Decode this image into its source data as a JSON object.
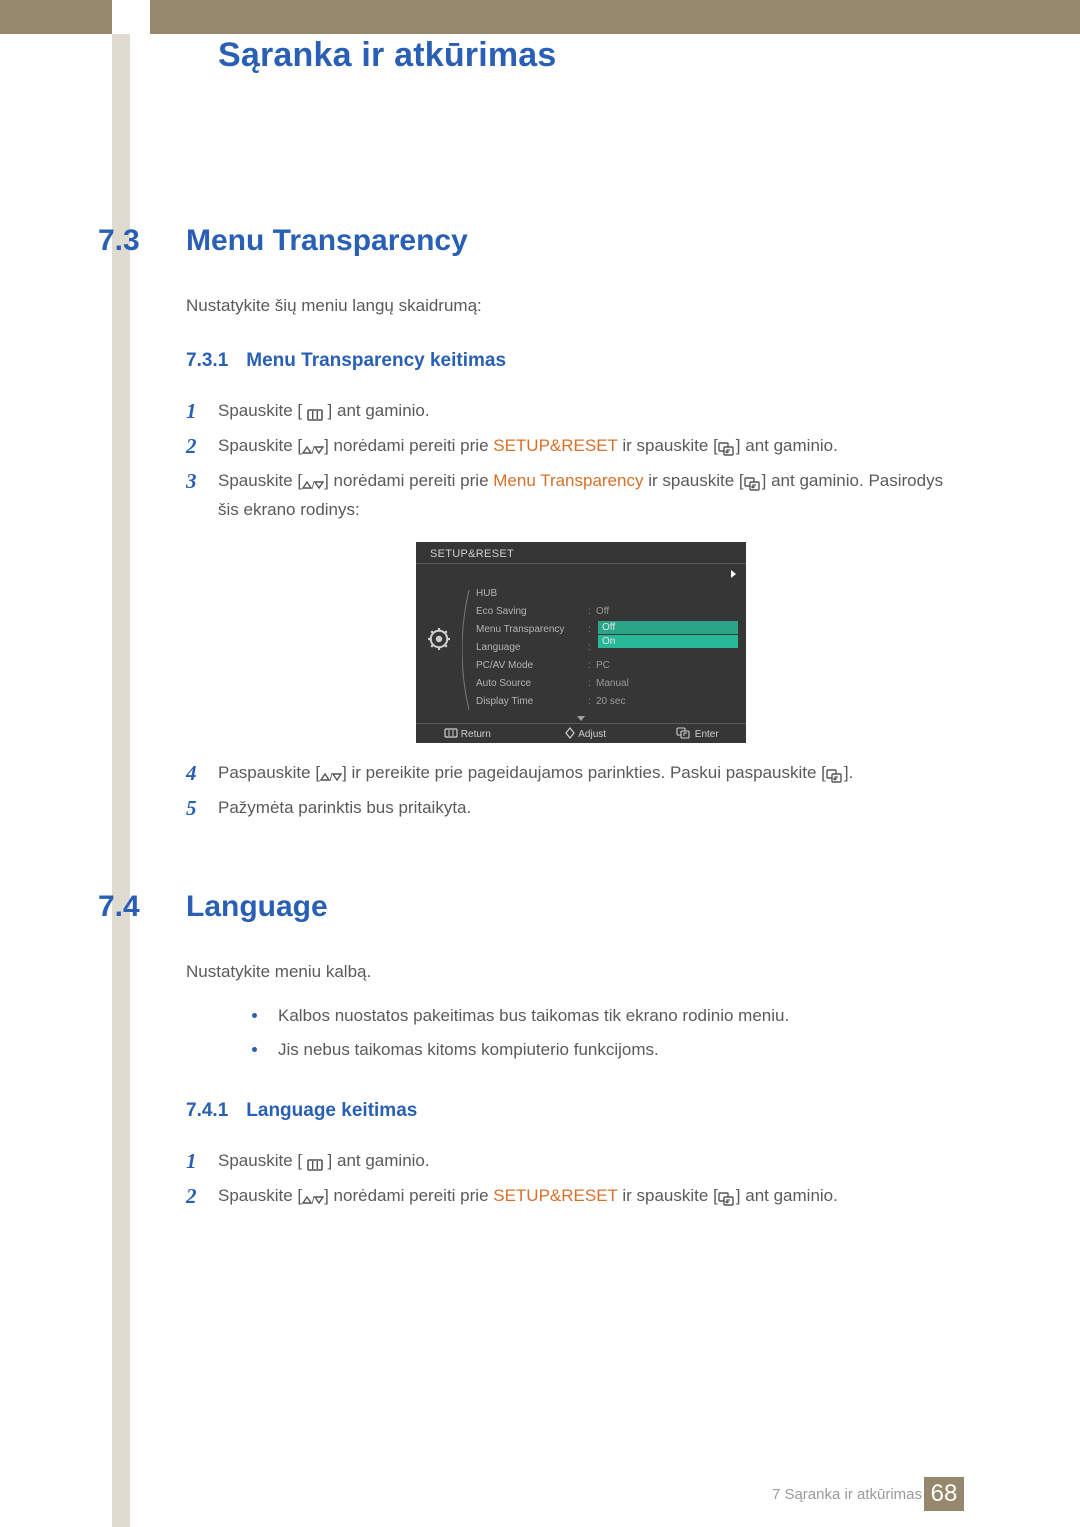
{
  "doc_title": "Sąranka ir atkūrimas",
  "section_7_3": {
    "num": "7.3",
    "title": "Menu Transparency",
    "intro": "Nustatykite šių meniu langų skaidrumą:"
  },
  "sub_7_3_1": {
    "num": "7.3.1",
    "title": "Menu Transparency keitimas"
  },
  "steps_731": {
    "s1": "Spauskite [ ",
    "s1b": " ] ant gaminio.",
    "s2a": "Spauskite [",
    "s2b": "] norėdami pereiti prie ",
    "s2c": "SETUP&RESET",
    "s2d": " ir spauskite [",
    "s2e": "] ant gaminio.",
    "s3a": "Spauskite [",
    "s3b": "] norėdami pereiti prie ",
    "s3c": "Menu Transparency",
    "s3d": " ir spauskite [",
    "s3e": "] ant gaminio. Pasirodys šis ekrano rodinys:",
    "s4a": "Paspauskite [",
    "s4b": "] ir pereikite prie pageidaujamos parinkties. Paskui paspauskite [",
    "s4c": "].",
    "s5": "Pažymėta parinktis bus pritaikyta."
  },
  "osd": {
    "head": "SETUP&RESET",
    "rows": [
      "HUB",
      "Eco Saving",
      "Menu Transparency",
      "Language",
      "PC/AV Mode",
      "Auto Source",
      "Display Time"
    ],
    "vals": {
      "eco": "Off",
      "sel_off": "Off",
      "sel_on": "On",
      "pcav": "PC",
      "autosrc": "Manual",
      "disp": "20 sec"
    },
    "btns": {
      "return": "Return",
      "adjust": "Adjust",
      "enter": "Enter"
    }
  },
  "section_7_4": {
    "num": "7.4",
    "title": "Language",
    "intro": "Nustatykite meniu kalbą."
  },
  "bullets_7_4": {
    "b1": "Kalbos nuostatos pakeitimas bus taikomas tik ekrano rodinio meniu.",
    "b2": "Jis nebus taikomas kitoms kompiuterio funkcijoms."
  },
  "sub_7_4_1": {
    "num": "7.4.1",
    "title": "Language keitimas"
  },
  "steps_741": {
    "s1": "Spauskite [ ",
    "s1b": " ] ant gaminio.",
    "s2a": "Spauskite [",
    "s2b": "] norėdami pereiti prie ",
    "s2c": "SETUP&RESET",
    "s2d": " ir spauskite [",
    "s2e": "] ant gaminio."
  },
  "footer": {
    "section": "7 Sąranka ir atkūrimas",
    "page": "68"
  }
}
